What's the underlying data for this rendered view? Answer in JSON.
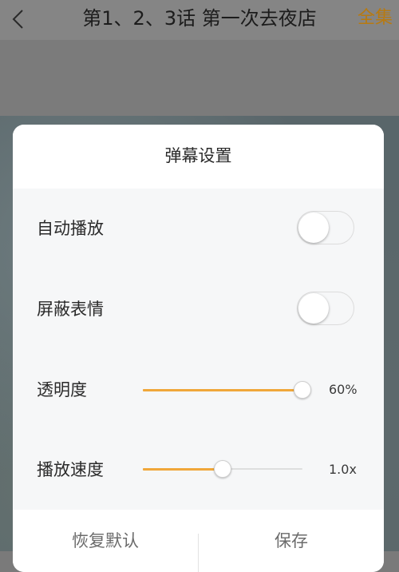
{
  "header": {
    "back_icon": "chevron-left-icon",
    "title": "第1、2、3话 第一次去夜店",
    "all_episodes_label": "全集"
  },
  "dialog": {
    "title": "弹幕设置",
    "auto_play": {
      "label": "自动播放",
      "on": false
    },
    "block_emoji": {
      "label": "屏蔽表情",
      "on": false
    },
    "opacity": {
      "label": "透明度",
      "value_text": "60%",
      "fill_fraction": 1.0
    },
    "speed": {
      "label": "播放速度",
      "value_text": "1.0x",
      "fill_fraction": 0.5
    },
    "reset_label": "恢复默认",
    "save_label": "保存"
  },
  "colors": {
    "accent": "#f0a73a",
    "all_episodes_text": "#b87a10"
  }
}
